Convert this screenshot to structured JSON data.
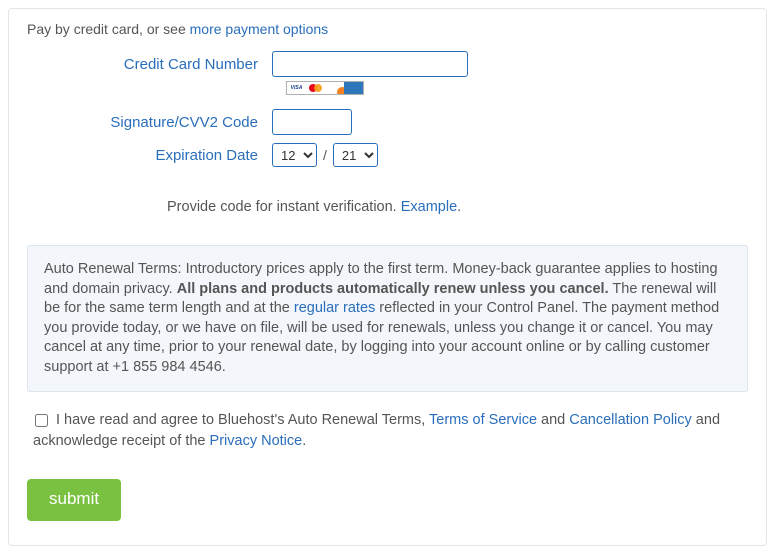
{
  "intro": {
    "prefix": "Pay by credit card, or see ",
    "link": "more payment options"
  },
  "labels": {
    "cc": "Credit Card Number",
    "cvv": "Signature/CVV2 Code",
    "exp": "Expiration Date"
  },
  "exp": {
    "month": "12",
    "year": "21",
    "slash": "/"
  },
  "verify": {
    "text": "Provide code for instant verification. ",
    "link": "Example",
    "dot": "."
  },
  "terms": {
    "t1": "Auto Renewal Terms: Introductory prices apply to the first term. Money-back guarantee applies to hosting and domain privacy. ",
    "t2": "All plans and products automatically renew unless you cancel.",
    "t3": " The renewal will be for the same term length and at the ",
    "regular": "regular rates",
    "t4": " reflected in your Control Panel. The payment method you provide today, or we have on file, will be used for renewals, unless you change it or cancel. You may cancel at any time, prior to your renewal date, by logging into your account online or by calling customer support at +1 855 984 4546."
  },
  "agree": {
    "a1": "I have read and agree to Bluehost's Auto Renewal Terms, ",
    "tos": "Terms of Service",
    "a2": " and ",
    "cancel": "Cancellation Policy",
    "a3": " and acknowledge receipt of the ",
    "privacy": "Privacy Notice",
    "a4": "."
  },
  "submit": "submit",
  "cards": {
    "visa": "VISA"
  }
}
